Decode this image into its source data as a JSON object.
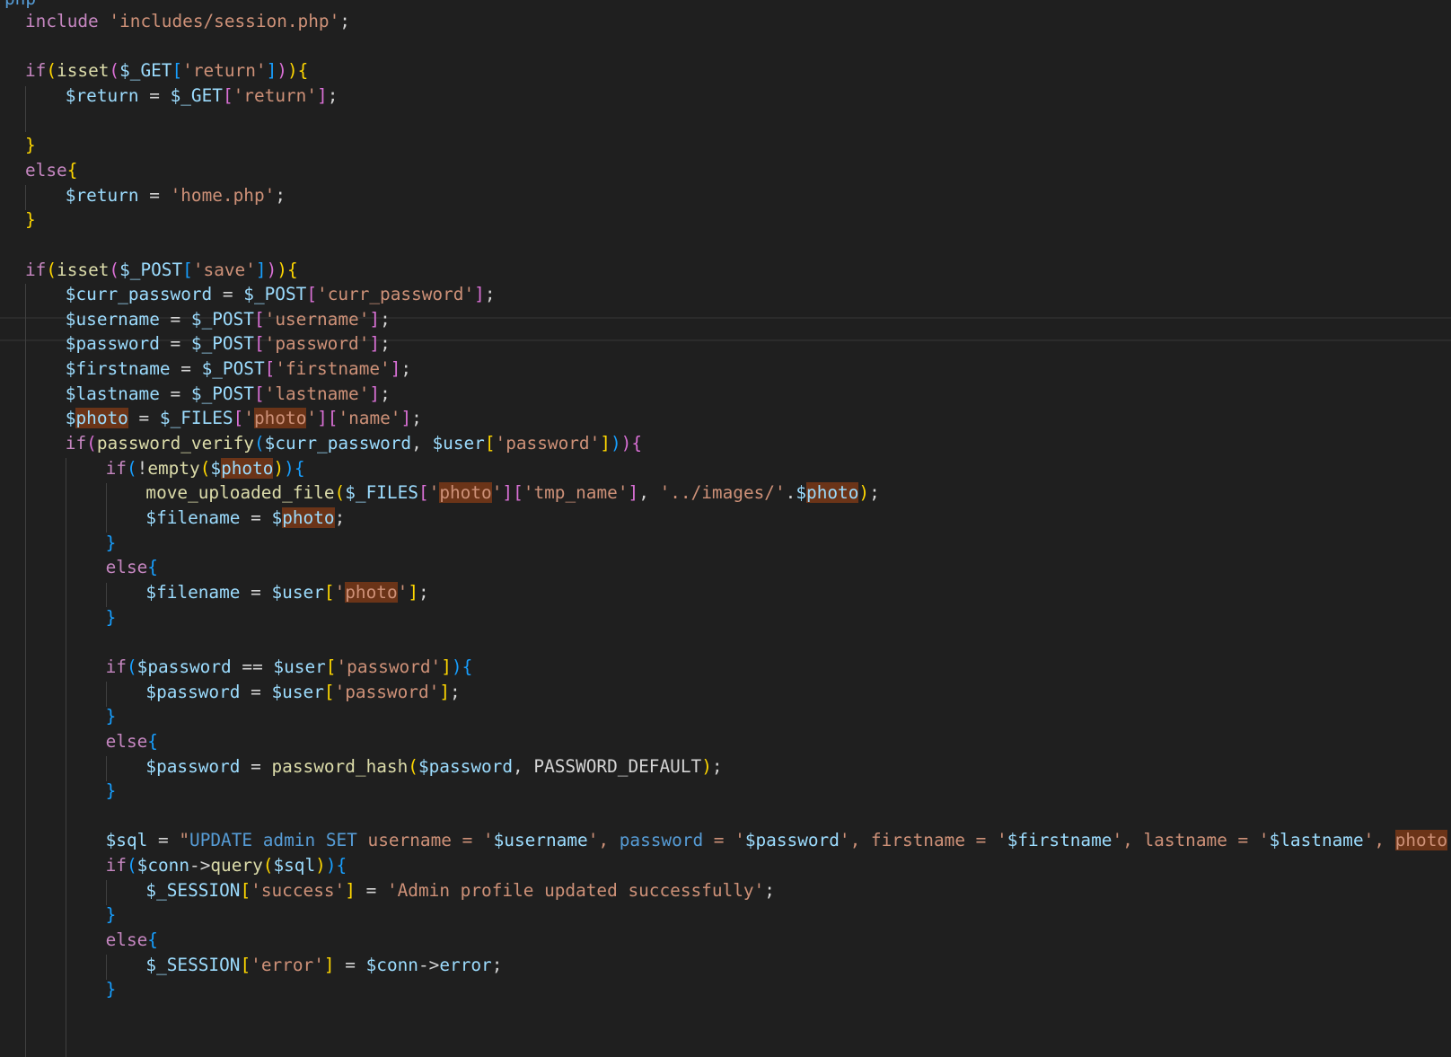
{
  "editor": {
    "background": "#1f1f1f",
    "header_fragment": "php",
    "highlighted_word": "photo",
    "lines": [
      {
        "indent": 0,
        "tokens": [
          [
            "include",
            "kw-c"
          ],
          [
            " ",
            "pl"
          ],
          [
            "'includes/session.php'",
            "str"
          ],
          [
            ";",
            "pl"
          ]
        ]
      },
      {
        "indent": 0,
        "tokens": []
      },
      {
        "indent": 0,
        "tokens": [
          [
            "if",
            "kw-c"
          ],
          [
            "(",
            "b1"
          ],
          [
            "isset",
            "fn"
          ],
          [
            "(",
            "b2"
          ],
          [
            "$_GET",
            "vr"
          ],
          [
            "[",
            "b3"
          ],
          [
            "'return'",
            "str"
          ],
          [
            "]",
            "b3"
          ],
          [
            ")",
            "b2"
          ],
          [
            ")",
            "b1"
          ],
          [
            "{",
            "b1"
          ]
        ]
      },
      {
        "indent": 1,
        "tokens": [
          [
            "$return",
            "vr"
          ],
          [
            " = ",
            "pl"
          ],
          [
            "$_GET",
            "vr"
          ],
          [
            "[",
            "b2"
          ],
          [
            "'return'",
            "str"
          ],
          [
            "]",
            "b2"
          ],
          [
            ";",
            "pl"
          ]
        ]
      },
      {
        "indent": 1,
        "tokens": []
      },
      {
        "indent": 0,
        "tokens": [
          [
            "}",
            "b1"
          ]
        ]
      },
      {
        "indent": 0,
        "tokens": [
          [
            "else",
            "kw-c"
          ],
          [
            "{",
            "b1"
          ]
        ]
      },
      {
        "indent": 1,
        "tokens": [
          [
            "$return",
            "vr"
          ],
          [
            " = ",
            "pl"
          ],
          [
            "'home.php'",
            "str"
          ],
          [
            ";",
            "pl"
          ]
        ]
      },
      {
        "indent": 0,
        "tokens": [
          [
            "}",
            "b1"
          ]
        ]
      },
      {
        "indent": 0,
        "tokens": []
      },
      {
        "indent": 0,
        "tokens": [
          [
            "if",
            "kw-c"
          ],
          [
            "(",
            "b1"
          ],
          [
            "isset",
            "fn"
          ],
          [
            "(",
            "b2"
          ],
          [
            "$_POST",
            "vr"
          ],
          [
            "[",
            "b3"
          ],
          [
            "'save'",
            "str"
          ],
          [
            "]",
            "b3"
          ],
          [
            ")",
            "b2"
          ],
          [
            ")",
            "b1"
          ],
          [
            "{",
            "b1"
          ]
        ]
      },
      {
        "indent": 1,
        "tokens": [
          [
            "$curr_password",
            "vr"
          ],
          [
            " = ",
            "pl"
          ],
          [
            "$_POST",
            "vr"
          ],
          [
            "[",
            "b2"
          ],
          [
            "'curr_password'",
            "str"
          ],
          [
            "]",
            "b2"
          ],
          [
            ";",
            "pl"
          ]
        ]
      },
      {
        "indent": 1,
        "tokens": [
          [
            "$username",
            "vr"
          ],
          [
            " = ",
            "pl"
          ],
          [
            "$_POST",
            "vr"
          ],
          [
            "[",
            "b2"
          ],
          [
            "'username'",
            "str"
          ],
          [
            "]",
            "b2"
          ],
          [
            ";",
            "pl"
          ]
        ]
      },
      {
        "indent": 1,
        "tokens": [
          [
            "$password",
            "vr"
          ],
          [
            " = ",
            "pl"
          ],
          [
            "$_POST",
            "vr"
          ],
          [
            "[",
            "b2"
          ],
          [
            "'password'",
            "str"
          ],
          [
            "]",
            "b2"
          ],
          [
            ";",
            "pl"
          ]
        ]
      },
      {
        "indent": 1,
        "tokens": [
          [
            "$firstname",
            "vr"
          ],
          [
            " = ",
            "pl"
          ],
          [
            "$_POST",
            "vr"
          ],
          [
            "[",
            "b2"
          ],
          [
            "'firstname'",
            "str"
          ],
          [
            "]",
            "b2"
          ],
          [
            ";",
            "pl"
          ]
        ]
      },
      {
        "indent": 1,
        "tokens": [
          [
            "$lastname",
            "vr"
          ],
          [
            " = ",
            "pl"
          ],
          [
            "$_POST",
            "vr"
          ],
          [
            "[",
            "b2"
          ],
          [
            "'lastname'",
            "str"
          ],
          [
            "]",
            "b2"
          ],
          [
            ";",
            "pl"
          ]
        ]
      },
      {
        "indent": 1,
        "tokens": [
          [
            "$",
            "vr"
          ],
          [
            "photo",
            "vr hl"
          ],
          [
            " = ",
            "pl"
          ],
          [
            "$_FILES",
            "vr"
          ],
          [
            "[",
            "b2"
          ],
          [
            "'",
            "str"
          ],
          [
            "photo",
            "str hl"
          ],
          [
            "'",
            "str"
          ],
          [
            "]",
            "b2"
          ],
          [
            "[",
            "b2"
          ],
          [
            "'name'",
            "str"
          ],
          [
            "]",
            "b2"
          ],
          [
            ";",
            "pl"
          ]
        ]
      },
      {
        "indent": 1,
        "tokens": [
          [
            "if",
            "kw-c"
          ],
          [
            "(",
            "b2"
          ],
          [
            "password_verify",
            "fn"
          ],
          [
            "(",
            "b3"
          ],
          [
            "$curr_password",
            "vr"
          ],
          [
            ", ",
            "pl"
          ],
          [
            "$user",
            "vr"
          ],
          [
            "[",
            "b1"
          ],
          [
            "'password'",
            "str"
          ],
          [
            "]",
            "b1"
          ],
          [
            ")",
            "b3"
          ],
          [
            ")",
            "b2"
          ],
          [
            "{",
            "b2"
          ]
        ]
      },
      {
        "indent": 2,
        "tokens": [
          [
            "if",
            "kw-c"
          ],
          [
            "(",
            "b3"
          ],
          [
            "!",
            "pl"
          ],
          [
            "empty",
            "fn"
          ],
          [
            "(",
            "b1"
          ],
          [
            "$",
            "vr"
          ],
          [
            "photo",
            "vr hl"
          ],
          [
            ")",
            "b1"
          ],
          [
            ")",
            "b3"
          ],
          [
            "{",
            "b3"
          ]
        ]
      },
      {
        "indent": 3,
        "tokens": [
          [
            "move_uploaded_file",
            "fn"
          ],
          [
            "(",
            "b1"
          ],
          [
            "$_FILES",
            "vr"
          ],
          [
            "[",
            "b2"
          ],
          [
            "'",
            "str"
          ],
          [
            "photo",
            "str hl"
          ],
          [
            "'",
            "str"
          ],
          [
            "]",
            "b2"
          ],
          [
            "[",
            "b2"
          ],
          [
            "'tmp_name'",
            "str"
          ],
          [
            "]",
            "b2"
          ],
          [
            ", ",
            "pl"
          ],
          [
            "'../images/'",
            "str"
          ],
          [
            ".",
            "pl"
          ],
          [
            "$",
            "vr"
          ],
          [
            "photo",
            "vr hl"
          ],
          [
            ")",
            "b1"
          ],
          [
            ";",
            "pl"
          ]
        ]
      },
      {
        "indent": 3,
        "tokens": [
          [
            "$filename",
            "vr"
          ],
          [
            " = ",
            "pl"
          ],
          [
            "$",
            "vr"
          ],
          [
            "photo",
            "vr hl"
          ],
          [
            ";",
            "pl"
          ]
        ]
      },
      {
        "indent": 2,
        "tokens": [
          [
            "}",
            "b3"
          ]
        ]
      },
      {
        "indent": 2,
        "tokens": [
          [
            "else",
            "kw-c"
          ],
          [
            "{",
            "b3"
          ]
        ]
      },
      {
        "indent": 3,
        "tokens": [
          [
            "$filename",
            "vr"
          ],
          [
            " = ",
            "pl"
          ],
          [
            "$user",
            "vr"
          ],
          [
            "[",
            "b1"
          ],
          [
            "'",
            "str"
          ],
          [
            "photo",
            "str hl"
          ],
          [
            "'",
            "str"
          ],
          [
            "]",
            "b1"
          ],
          [
            ";",
            "pl"
          ]
        ]
      },
      {
        "indent": 2,
        "tokens": [
          [
            "}",
            "b3"
          ]
        ]
      },
      {
        "indent": 2,
        "tokens": []
      },
      {
        "indent": 2,
        "tokens": [
          [
            "if",
            "kw-c"
          ],
          [
            "(",
            "b3"
          ],
          [
            "$password",
            "vr"
          ],
          [
            " == ",
            "pl"
          ],
          [
            "$user",
            "vr"
          ],
          [
            "[",
            "b1"
          ],
          [
            "'password'",
            "str"
          ],
          [
            "]",
            "b1"
          ],
          [
            ")",
            "b3"
          ],
          [
            "{",
            "b3"
          ]
        ]
      },
      {
        "indent": 3,
        "tokens": [
          [
            "$password",
            "vr"
          ],
          [
            " = ",
            "pl"
          ],
          [
            "$user",
            "vr"
          ],
          [
            "[",
            "b1"
          ],
          [
            "'password'",
            "str"
          ],
          [
            "]",
            "b1"
          ],
          [
            ";",
            "pl"
          ]
        ]
      },
      {
        "indent": 2,
        "tokens": [
          [
            "}",
            "b3"
          ]
        ]
      },
      {
        "indent": 2,
        "tokens": [
          [
            "else",
            "kw-c"
          ],
          [
            "{",
            "b3"
          ]
        ]
      },
      {
        "indent": 3,
        "tokens": [
          [
            "$password",
            "vr"
          ],
          [
            " = ",
            "pl"
          ],
          [
            "password_hash",
            "fn"
          ],
          [
            "(",
            "b1"
          ],
          [
            "$password",
            "vr"
          ],
          [
            ", ",
            "pl"
          ],
          [
            "PASSWORD_DEFAULT",
            "pl"
          ],
          [
            ")",
            "b1"
          ],
          [
            ";",
            "pl"
          ]
        ]
      },
      {
        "indent": 2,
        "tokens": [
          [
            "}",
            "b3"
          ]
        ]
      },
      {
        "indent": 2,
        "tokens": []
      },
      {
        "indent": 2,
        "tokens": [
          [
            "$sql",
            "vr"
          ],
          [
            " = ",
            "pl"
          ],
          [
            "\"",
            "str"
          ],
          [
            "UPDATE",
            "kw-s"
          ],
          [
            " ",
            "str"
          ],
          [
            "admin",
            "kw-s"
          ],
          [
            " ",
            "str"
          ],
          [
            "SET",
            "kw-s"
          ],
          [
            " username = '",
            "str"
          ],
          [
            "$username",
            "vr"
          ],
          [
            "', ",
            "str"
          ],
          [
            "password",
            "kw-s"
          ],
          [
            " = '",
            "str"
          ],
          [
            "$password",
            "vr"
          ],
          [
            "', firstname = '",
            "str"
          ],
          [
            "$firstname",
            "vr"
          ],
          [
            "', lastname = '",
            "str"
          ],
          [
            "$lastname",
            "vr"
          ],
          [
            "', ",
            "str"
          ],
          [
            "photo",
            "str hl"
          ],
          [
            " = '",
            "str"
          ]
        ]
      },
      {
        "indent": 2,
        "tokens": [
          [
            "if",
            "kw-c"
          ],
          [
            "(",
            "b3"
          ],
          [
            "$conn",
            "vr"
          ],
          [
            "->",
            "pl"
          ],
          [
            "query",
            "fn"
          ],
          [
            "(",
            "b1"
          ],
          [
            "$sql",
            "vr"
          ],
          [
            ")",
            "b1"
          ],
          [
            ")",
            "b3"
          ],
          [
            "{",
            "b3"
          ]
        ]
      },
      {
        "indent": 3,
        "tokens": [
          [
            "$_SESSION",
            "vr"
          ],
          [
            "[",
            "b1"
          ],
          [
            "'success'",
            "str"
          ],
          [
            "]",
            "b1"
          ],
          [
            " = ",
            "pl"
          ],
          [
            "'Admin profile updated successfully'",
            "str"
          ],
          [
            ";",
            "pl"
          ]
        ]
      },
      {
        "indent": 2,
        "tokens": [
          [
            "}",
            "b3"
          ]
        ]
      },
      {
        "indent": 2,
        "tokens": [
          [
            "else",
            "kw-c"
          ],
          [
            "{",
            "b3"
          ]
        ]
      },
      {
        "indent": 3,
        "tokens": [
          [
            "$_SESSION",
            "vr"
          ],
          [
            "[",
            "b1"
          ],
          [
            "'error'",
            "str"
          ],
          [
            "]",
            "b1"
          ],
          [
            " = ",
            "pl"
          ],
          [
            "$conn",
            "vr"
          ],
          [
            "->",
            "pl"
          ],
          [
            "error",
            "vr"
          ],
          [
            ";",
            "pl"
          ]
        ]
      },
      {
        "indent": 2,
        "tokens": [
          [
            "}",
            "b3"
          ]
        ]
      }
    ]
  }
}
